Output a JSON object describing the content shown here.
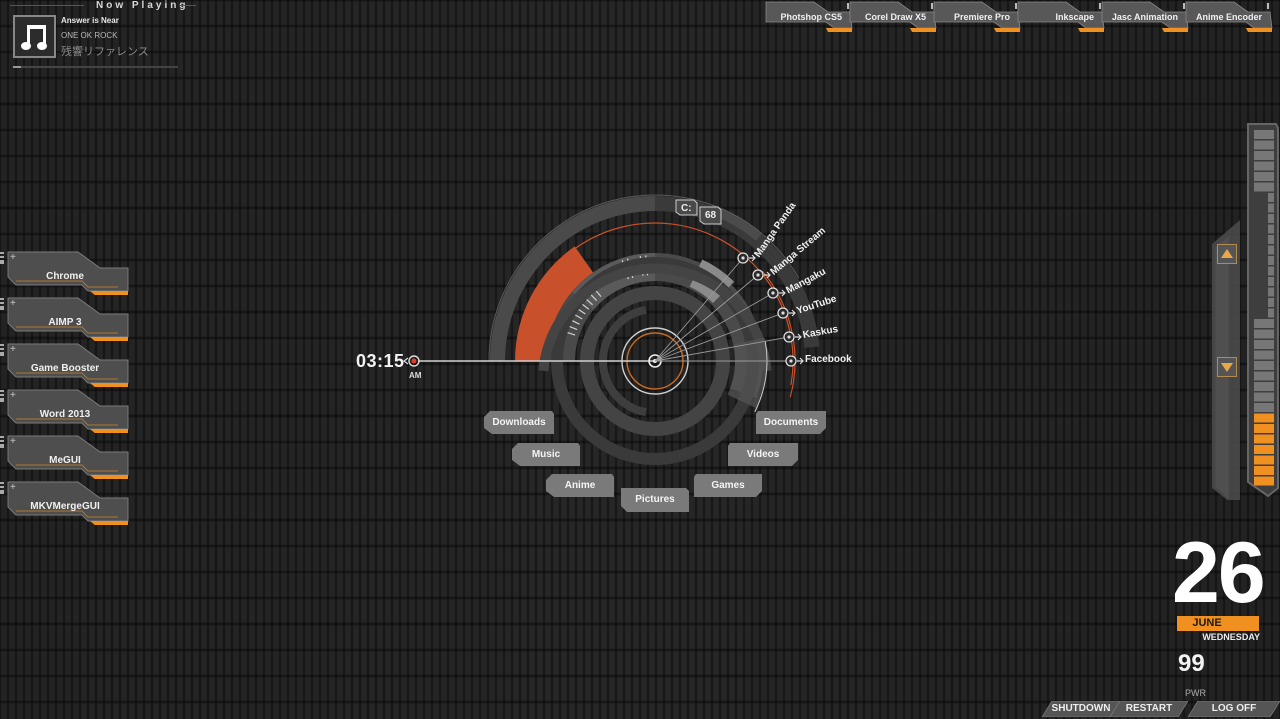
{
  "now_playing": {
    "title": "Now Playing",
    "song": "Answer is Near",
    "artist": "ONE OK ROCK",
    "album": "残響リファレンス",
    "art_icon": "music-note-icon",
    "progress_percent": 5
  },
  "top_apps": [
    {
      "label": "Photshop CS5"
    },
    {
      "label": "Corel Draw X5"
    },
    {
      "label": "Premiere Pro"
    },
    {
      "label": "Inkscape"
    },
    {
      "label": "Jasc Animation"
    },
    {
      "label": "Anime Encoder"
    }
  ],
  "launcher": [
    {
      "label": "Chrome"
    },
    {
      "label": "AIMP 3"
    },
    {
      "label": "Game Booster"
    },
    {
      "label": "Word 2013"
    },
    {
      "label": "MeGUI"
    },
    {
      "label": "MKVMergeGUI"
    }
  ],
  "launcher_plus": "+",
  "clock": {
    "time": "03:15",
    "ampm": "AM"
  },
  "drive": {
    "label": "C:",
    "value": "68"
  },
  "links": [
    {
      "label": "Manga Panda"
    },
    {
      "label": "Manga Stream"
    },
    {
      "label": "Mangaku"
    },
    {
      "label": "YouTube"
    },
    {
      "label": "Kaskus"
    },
    {
      "label": "Facebook"
    }
  ],
  "folders": [
    {
      "label": "Downloads"
    },
    {
      "label": "Music"
    },
    {
      "label": "Anime"
    },
    {
      "label": "Pictures"
    },
    {
      "label": "Games"
    },
    {
      "label": "Videos"
    },
    {
      "label": "Documents"
    }
  ],
  "volume": {
    "level_percent": 20,
    "up_icon": "triangle-up-icon",
    "down_icon": "triangle-down-icon"
  },
  "date": {
    "day": "26",
    "month": "JUNE",
    "weekday": "WEDNESDAY"
  },
  "power": {
    "value": "99",
    "label": "PWR"
  },
  "power_buttons": [
    {
      "label": "SHUTDOWN"
    },
    {
      "label": "RESTART"
    },
    {
      "label": "LOG OFF"
    }
  ],
  "colors": {
    "accent": "#f09020",
    "hud_red": "#c8502a",
    "panel": "#555555"
  }
}
